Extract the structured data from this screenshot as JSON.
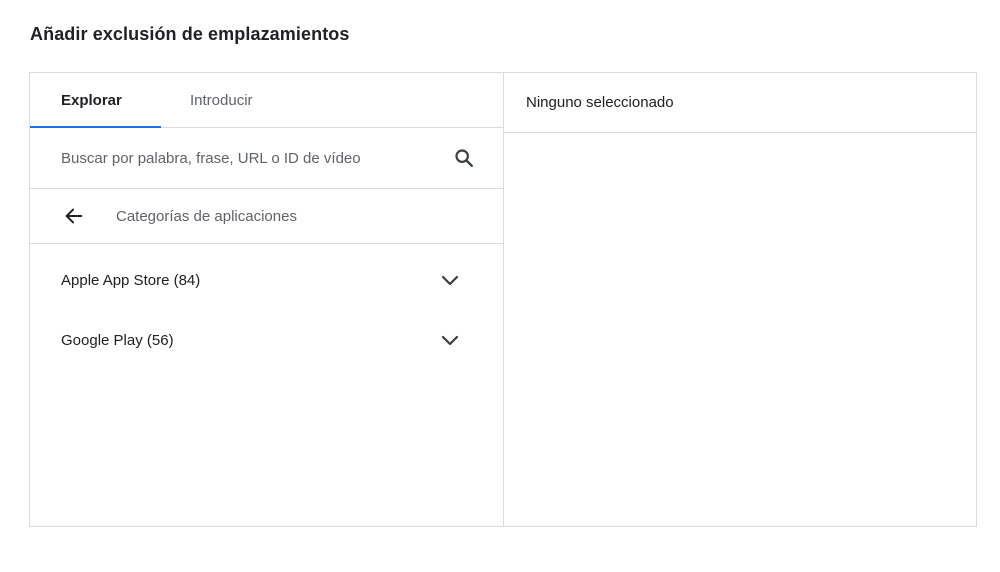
{
  "title": "Añadir exclusión de emplazamientos",
  "tabs": {
    "explore": "Explorar",
    "enter": "Introducir"
  },
  "search": {
    "placeholder": "Buscar por palabra, frase, URL o ID de vídeo",
    "value": ""
  },
  "breadcrumb": {
    "label": "Categorías de aplicaciones"
  },
  "categories": [
    {
      "label": "Apple App Store (84)"
    },
    {
      "label": "Google Play (56)"
    }
  ],
  "selected_panel": {
    "header": "Ninguno seleccionado"
  },
  "colors": {
    "accent": "#1a73e8",
    "border": "#dadce0",
    "text_primary": "#202124",
    "text_secondary": "#5f6368"
  },
  "icons": {
    "search": "search-icon",
    "back": "arrow-back-icon",
    "expand": "chevron-down-icon"
  }
}
